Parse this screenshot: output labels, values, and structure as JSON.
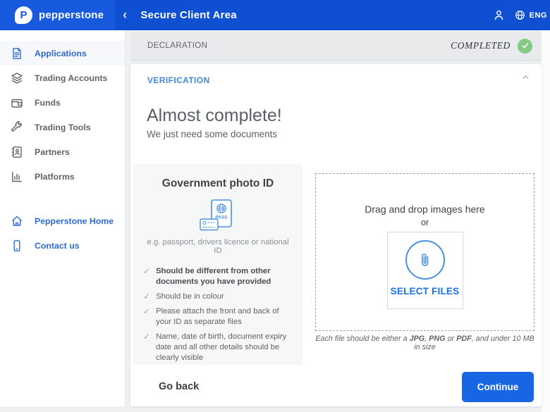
{
  "colors": {
    "header_blue": "#0f50d2",
    "header_blue_light": "#175ade",
    "link_blue": "#2e6bd0",
    "verification_blue": "#4288d5",
    "select_files_blue": "#1a73e8",
    "continue_blue": "#1866e4",
    "success_green": "#84c984"
  },
  "header": {
    "logo_letter": "P",
    "logo_text": "pepperstone",
    "back_icon": "‹",
    "title": "Secure Client Area",
    "language": "ENG"
  },
  "sidebar": {
    "items": [
      {
        "label": "Applications"
      },
      {
        "label": "Trading Accounts"
      },
      {
        "label": "Funds"
      },
      {
        "label": "Trading Tools"
      },
      {
        "label": "Partners"
      },
      {
        "label": "Platforms"
      }
    ],
    "footer_items": [
      {
        "label": "Pepperstone Home"
      },
      {
        "label": "Contact us"
      }
    ]
  },
  "declaration": {
    "title": "DECLARATION",
    "status": "COMPLETED"
  },
  "verification": {
    "section_title": "VERIFICATION",
    "heading": "Almost complete!",
    "subheading": "We just need some documents",
    "document_card": {
      "title": "Government photo ID",
      "icon_label": "PASS",
      "example": "e.g. passport, drivers licence or national ID",
      "requirements": [
        "Should be different from other documents you have provided",
        "Should be in colour",
        "Please attach the front and back of your ID as separate files",
        "Name, date of birth, document expiry date and all other details should be clearly visible"
      ]
    },
    "dropzone": {
      "drag_text": "Drag and drop images here",
      "or_text": "or",
      "select_button": "SELECT FILES",
      "note_parts": [
        "Each file should be either a ",
        "JPG",
        ", ",
        "PNG",
        " or ",
        "PDF",
        ", and under 10 MB in size"
      ]
    }
  },
  "actions": {
    "go_back": "Go back",
    "continue": "Continue"
  }
}
